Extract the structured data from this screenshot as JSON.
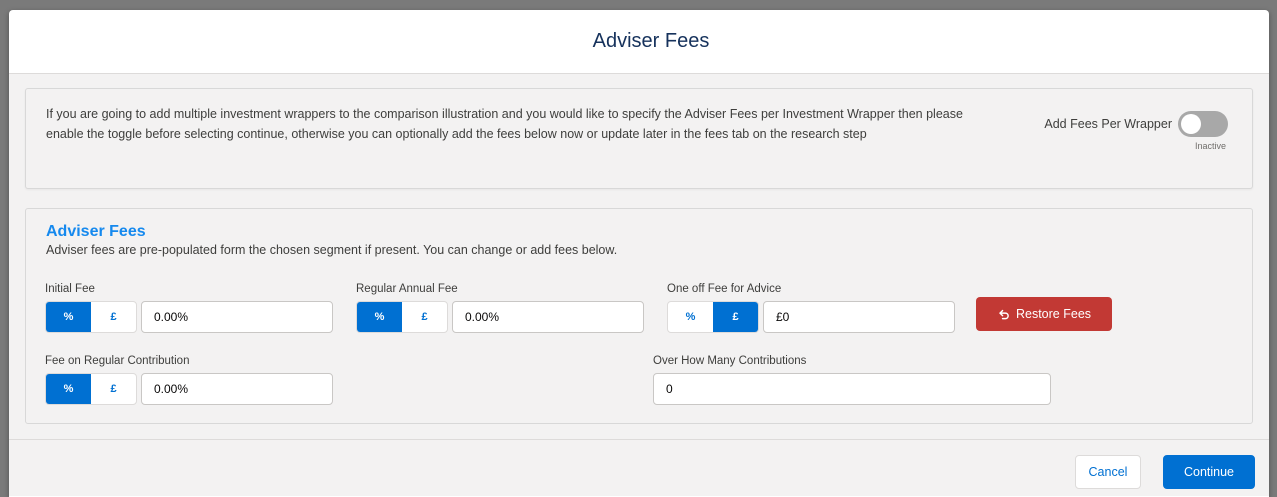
{
  "modal": {
    "title": "Adviser Fees"
  },
  "info": {
    "text": "If you are going to add multiple investment wrappers to the comparison illustration and you would like to specify the Adviser Fees per Investment Wrapper then please enable the toggle before selecting continue, otherwise you can optionally add the fees below now or update later in the fees tab on the research step",
    "toggle_label": "Add Fees Per Wrapper",
    "toggle_status": "Inactive",
    "toggle_on": false
  },
  "fees": {
    "title": "Adviser Fees",
    "description": "Adviser fees are pre-populated form the chosen segment if present. You can change or add fees below.",
    "percent_symbol": "%",
    "pound_symbol": "£",
    "initial_fee": {
      "label": "Initial Fee",
      "value": "0.00%",
      "selected": "%"
    },
    "regular_annual_fee": {
      "label": "Regular Annual Fee",
      "value": "0.00%",
      "selected": "%"
    },
    "one_off_fee": {
      "label": "One off Fee for Advice",
      "value": "£0",
      "selected": "£"
    },
    "regular_contribution_fee": {
      "label": "Fee on Regular Contribution",
      "value": "0.00%",
      "selected": "%"
    },
    "contributions_count": {
      "label": "Over How Many Contributions",
      "value": "0"
    },
    "restore_label": "Restore Fees"
  },
  "footer": {
    "cancel_label": "Cancel",
    "continue_label": "Continue"
  },
  "colors": {
    "brand_blue": "#0070d2",
    "title_blue": "#1589ee",
    "restore_red": "#c23934",
    "toggle_off": "#a8a8a8"
  }
}
